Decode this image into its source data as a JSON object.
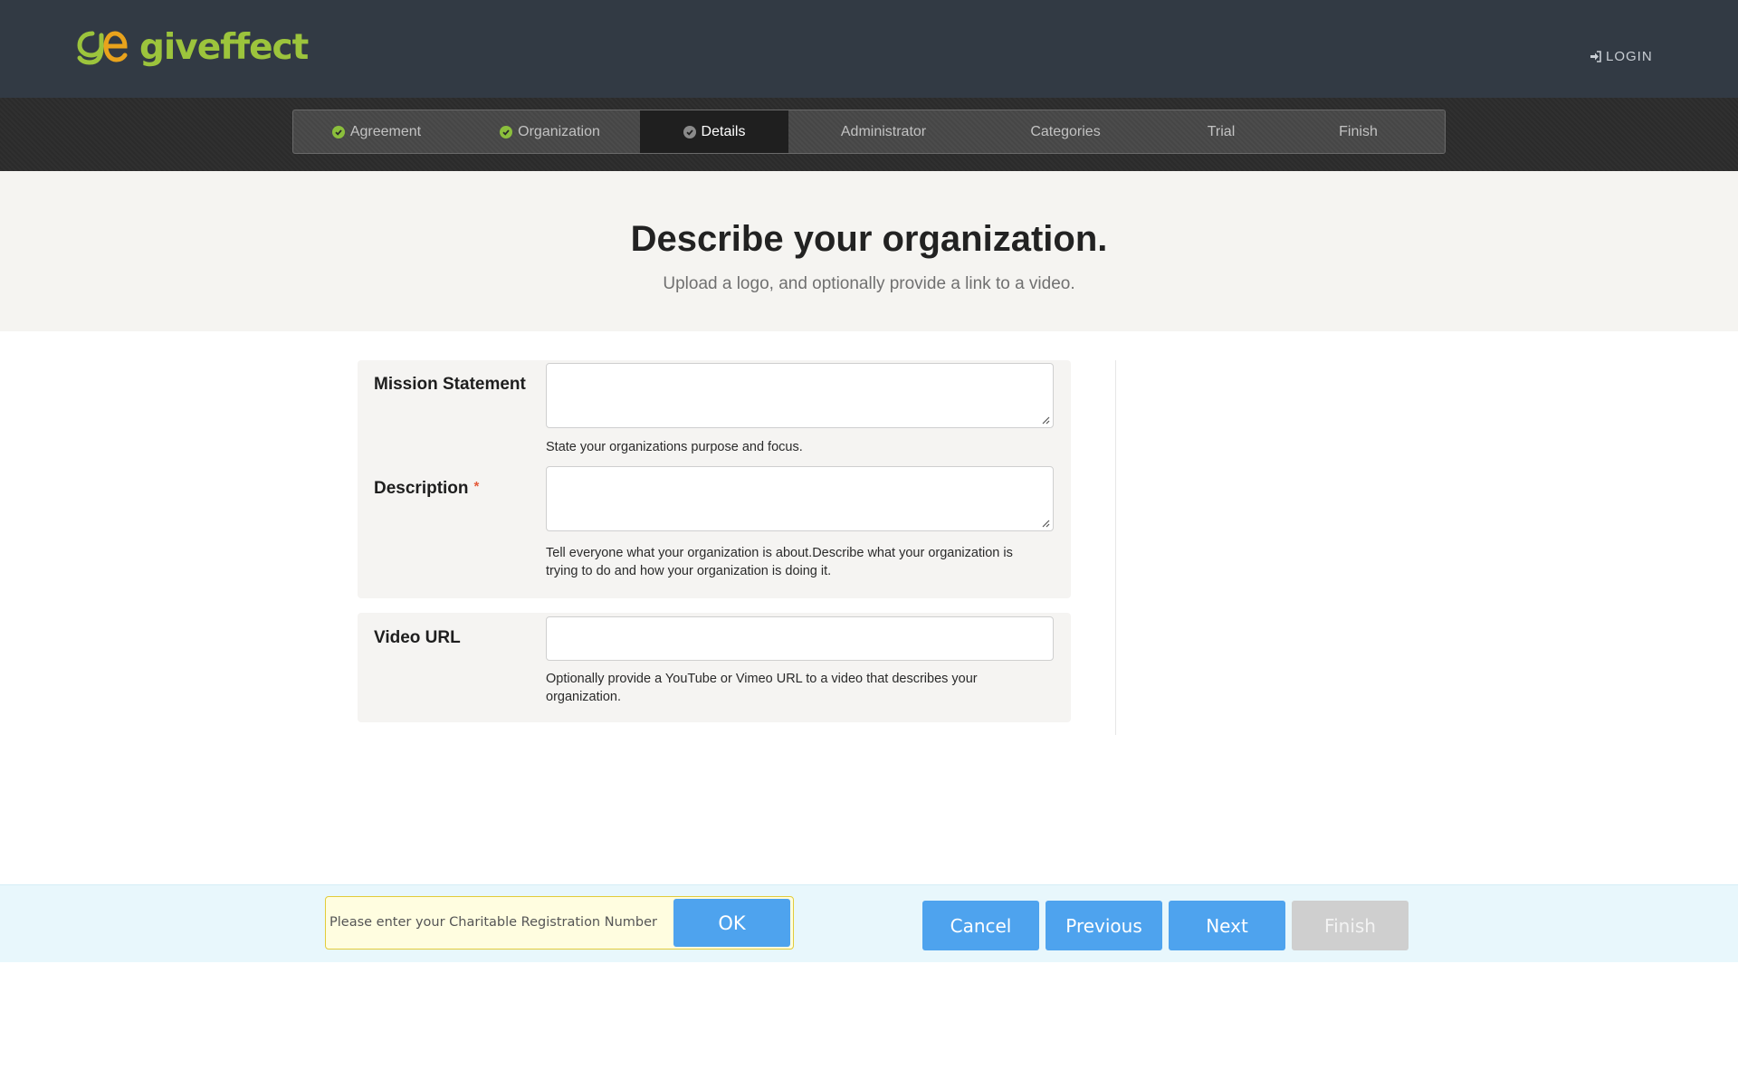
{
  "header": {
    "brand": "giveffect",
    "login_label": "LOGIN"
  },
  "steps": [
    {
      "label": "Agreement",
      "state": "done"
    },
    {
      "label": "Organization",
      "state": "done"
    },
    {
      "label": "Details",
      "state": "active"
    },
    {
      "label": "Administrator",
      "state": "pending"
    },
    {
      "label": "Categories",
      "state": "pending"
    },
    {
      "label": "Trial",
      "state": "pending"
    },
    {
      "label": "Finish",
      "state": "pending"
    }
  ],
  "hero": {
    "title": "Describe your organization.",
    "subtitle": "Upload a logo, and optionally provide a link to a video."
  },
  "form": {
    "mission": {
      "label": "Mission Statement",
      "value": "",
      "help": "State your organizations purpose and focus."
    },
    "description": {
      "label": "Description",
      "required_mark": "*",
      "value": "",
      "help": "Tell everyone what your organization is about.Describe what your organization is trying to do and how your organization is doing it."
    },
    "video": {
      "label": "Video URL",
      "value": "",
      "help": "Optionally provide a YouTube or Vimeo URL to a video that describes your organization."
    }
  },
  "footer": {
    "registration_prompt": "Please enter your Charitable Registration Number",
    "ok_label": "OK",
    "cancel_label": "Cancel",
    "previous_label": "Previous",
    "next_label": "Next",
    "finish_label": "Finish"
  },
  "colors": {
    "header_bg": "#323a44",
    "brand_green": "#9cc43c",
    "check_green": "#8bbf3c",
    "button_blue": "#4ea3ee",
    "button_disabled": "#cfcfcf",
    "required_red": "#e55a3a"
  },
  "icons": {
    "logo": "ge-logo-mark",
    "login": "sign-in-icon",
    "step_done": "check-circle-icon",
    "step_active": "circle-icon",
    "resize": "resize-grip-icon"
  }
}
